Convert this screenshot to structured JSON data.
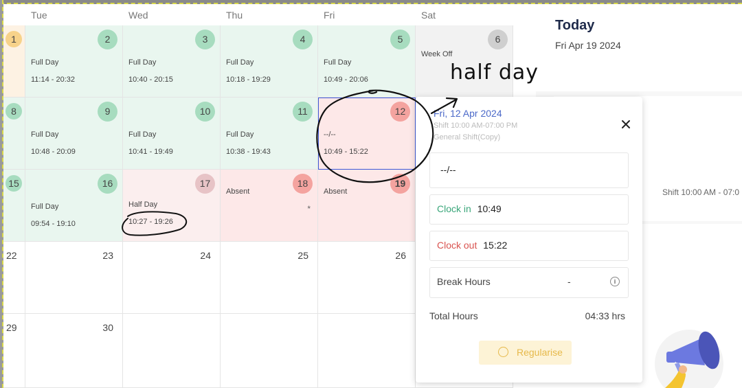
{
  "weekdays": [
    "Tue",
    "Wed",
    "Thu",
    "Fri",
    "Sat"
  ],
  "calendar": {
    "row1": {
      "mon": {
        "day": "1"
      },
      "tue": {
        "day": "2",
        "status": "Full Day",
        "time": "11:14 - 20:32"
      },
      "wed": {
        "day": "3",
        "status": "Full Day",
        "time": "10:40 - 20:15"
      },
      "thu": {
        "day": "4",
        "status": "Full Day",
        "time": "10:18 - 19:29"
      },
      "fri": {
        "day": "5",
        "status": "Full Day",
        "time": "10:49 - 20:06"
      },
      "sat": {
        "day": "6",
        "status": "Week Off"
      }
    },
    "row2": {
      "mon": {
        "day": "8"
      },
      "tue": {
        "day": "9",
        "status": "Full Day",
        "time": "10:48 - 20:09"
      },
      "wed": {
        "day": "10",
        "status": "Full Day",
        "time": "10:41 - 19:49"
      },
      "thu": {
        "day": "11",
        "status": "Full Day",
        "time": "10:38 - 19:43"
      },
      "fri": {
        "day": "12",
        "status": "--/--",
        "time": "10:49 - 15:22"
      }
    },
    "row3": {
      "mon": {
        "day": "15"
      },
      "tue": {
        "day": "16",
        "status": "Full Day",
        "time": "09:54 - 19:10"
      },
      "wed": {
        "day": "17",
        "status": "Half Day",
        "time": "10:27 - 19:26"
      },
      "thu": {
        "day": "18",
        "status": "Absent",
        "marker": "*"
      },
      "fri": {
        "day": "19",
        "status": "Absent"
      }
    },
    "row4": {
      "mon": "22",
      "tue": "23",
      "wed": "24",
      "thu": "25",
      "fri": "26"
    },
    "row5": {
      "mon": "29",
      "tue": "30"
    }
  },
  "today": {
    "title": "Today",
    "date": "Fri Apr 19 2024",
    "shift": "Shift 10:00 AM - 07:0"
  },
  "popup": {
    "date": "Fri, 12 Apr 2024",
    "shift": "Shift 10:00 AM-07:00 PM",
    "shift_name": "General Shift(Copy)",
    "status": "--/--",
    "clock_in_label": "Clock in",
    "clock_in": "10:49",
    "clock_out_label": "Clock out",
    "clock_out": "15:22",
    "break_label": "Break Hours",
    "break_value": "-",
    "total_label": "Total Hours",
    "total_value": "04:33 hrs",
    "regularise_label": "Regularise"
  },
  "annotation": "half day",
  "colors": {
    "present": "#e9f6ef",
    "absent": "#fde8e8",
    "week_off": "#f2f2f2",
    "accent_blue": "#4a68c8",
    "clock_in": "#3aa67a",
    "clock_out": "#d9534f",
    "regularise": "#e6b94a"
  }
}
